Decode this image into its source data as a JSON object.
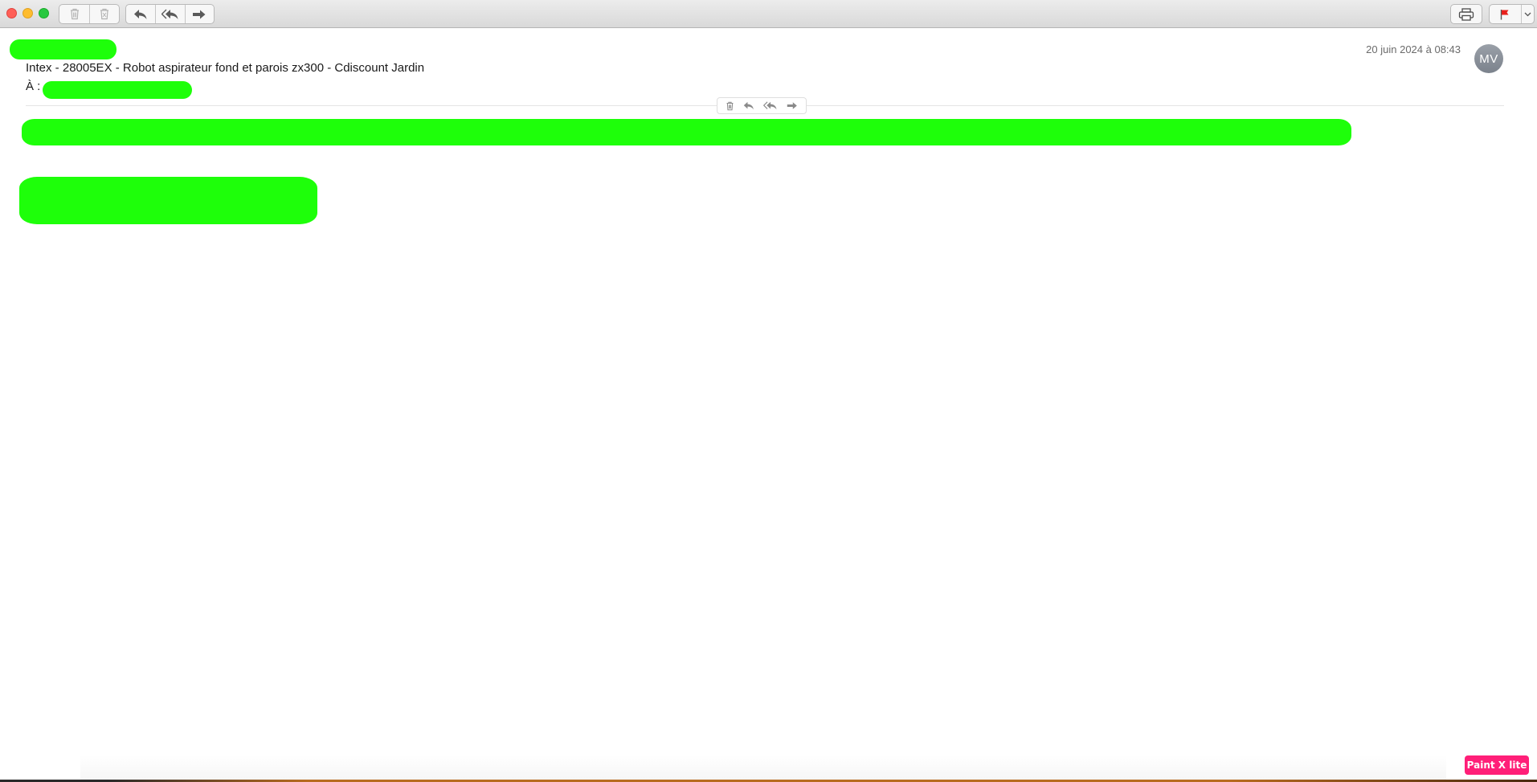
{
  "toolbar": {
    "buttons": [
      "trash-icon",
      "junk-icon",
      "reply-icon",
      "reply-all-icon",
      "forward-icon",
      "print-icon",
      "flag-icon",
      "chevron-down-icon"
    ]
  },
  "message": {
    "subject": "Intex - 28005EX - Robot aspirateur fond et parois zx300 - Cdiscount Jardin",
    "to_label": "À :",
    "date": "20 juin 2024 à 08:43",
    "avatar_initials": "MV"
  },
  "overlay": {
    "badge": "Paint X lite"
  },
  "colors": {
    "redaction": "#1eff0a",
    "flag": "#e8201c",
    "badge": "#ff1f78"
  }
}
